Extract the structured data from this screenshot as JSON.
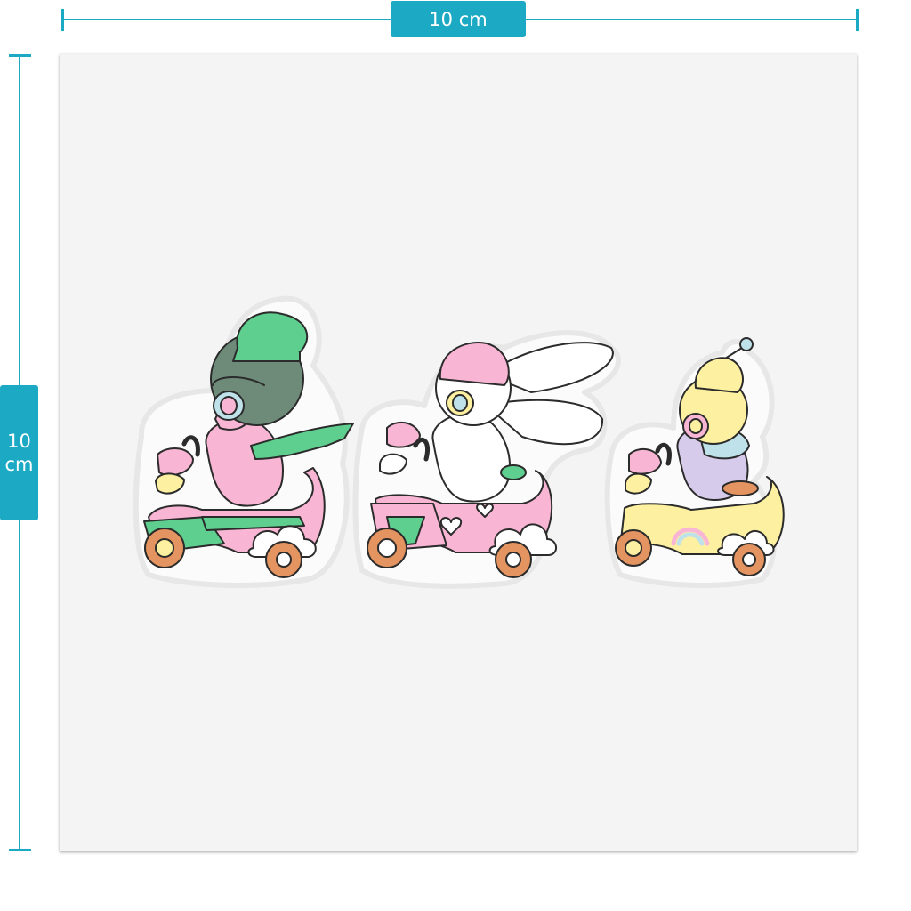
{
  "dimensions": {
    "width_label": "10 cm",
    "height_label_value": "10",
    "height_label_unit": "cm"
  },
  "colors": {
    "accent": "#1ba9c4",
    "sheet": "#f4f4f4",
    "green": "#5ecf8f",
    "pink": "#f8b6d4",
    "yellow": "#fdf0a0",
    "lavender": "#d6cbea",
    "orange": "#e39460",
    "outline": "#2b2b2b"
  },
  "stickers": [
    {
      "icon": "green-hat-rider-sticker-icon"
    },
    {
      "icon": "white-bunny-rider-sticker-icon"
    },
    {
      "icon": "yellow-robot-rider-sticker-icon"
    }
  ]
}
